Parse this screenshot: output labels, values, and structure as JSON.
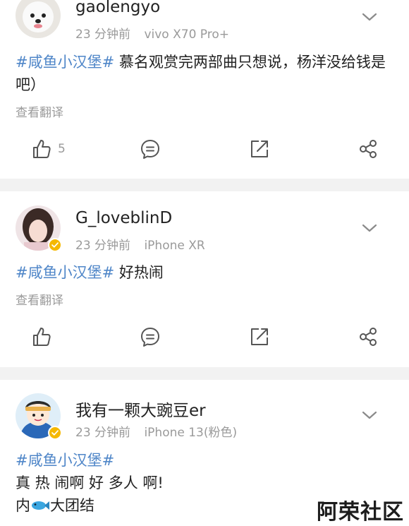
{
  "posts": [
    {
      "username": "gaolengyo",
      "time": "23 分钟前",
      "device": "vivo X70 Pro+",
      "hashtag": "#咸鱼小汉堡#",
      "text": " 慕名观赏完两部曲只想说，杨洋没给钱是吧）",
      "translate": "查看翻译",
      "like_count": "5"
    },
    {
      "username": "G_loveblinD",
      "time": "23 分钟前",
      "device": "iPhone XR",
      "hashtag": "#咸鱼小汉堡#",
      "text": " 好热闹",
      "translate": "查看翻译",
      "like_count": ""
    },
    {
      "username": "我有一颗大豌豆er",
      "time": "23 分钟前",
      "device": "iPhone 13(粉色)",
      "hashtag": "#咸鱼小汉堡#",
      "line2": "真 热 闹啊 好 多人 啊!",
      "line3_pre": "内",
      "line3_post": "大团结"
    }
  ],
  "watermark": "阿荣社区",
  "colors": {
    "hashtag": "#4f86c8",
    "meta": "#9a9a9a",
    "separator": "#f2f2f2",
    "verified": "#f5b800"
  }
}
